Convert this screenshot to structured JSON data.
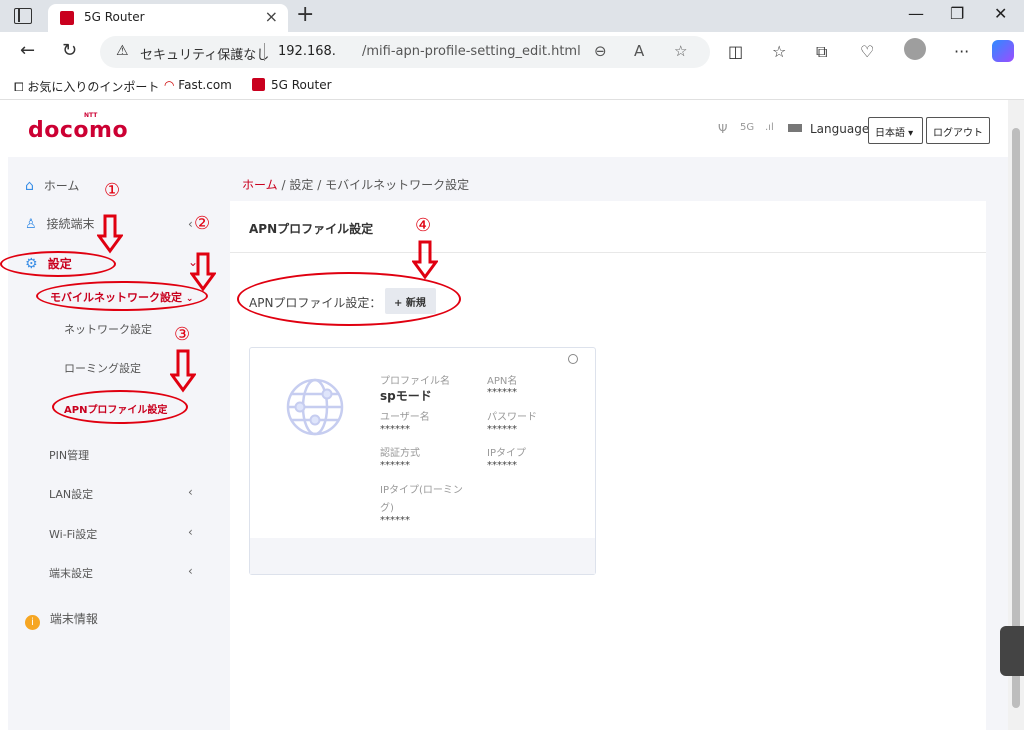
{
  "browser": {
    "tab_title": "5G Router",
    "security_text": "セキュリティ保護なし",
    "url_host": "192.168.",
    "url_path": "/mifi-apn-profile-setting_edit.html",
    "favorites": [
      "お気に入りのインポート",
      "Fast.com",
      "5G Router"
    ]
  },
  "header": {
    "logo": "docomo",
    "logo_small": "NTT",
    "network": "5G",
    "language_label": "Language",
    "language_button": "日本語 ▾",
    "logout_button": "ログアウト"
  },
  "sidebar": {
    "home": "ホーム",
    "devices": "接続端末",
    "settings": "設定",
    "mobile_network": "モバイルネットワーク設定",
    "network_settings": "ネットワーク設定",
    "roaming": "ローミング設定",
    "apn_profile": "APNプロファイル設定",
    "pin": "PIN管理",
    "lan": "LAN設定",
    "wifi": "Wi-Fi設定",
    "device_settings": "端末設定",
    "device_info": "端末情報"
  },
  "breadcrumb": {
    "home": "ホーム",
    "sep": "/",
    "settings": "設定",
    "mobile_network": "モバイルネットワーク設定"
  },
  "main": {
    "card_title": "APNプロファイル設定",
    "apn_label": "APNプロファイル設定：",
    "new_button": "+ 新規",
    "profile": {
      "profile_name_label": "プロファイル名",
      "profile_name": "spモード",
      "apn_name_label": "APN名",
      "apn_name": "******",
      "user_name_label": "ユーザー名",
      "user_name": "******",
      "password_label": "パスワード",
      "password": "******",
      "auth_label": "認証方式",
      "auth": "******",
      "ip_type_label": "IPタイプ",
      "ip_type": "******",
      "ip_roaming_label_1": "IPタイプ(ローミン",
      "ip_roaming_label_2": "グ)",
      "ip_roaming": "******"
    }
  },
  "annotations": [
    "①",
    "②",
    "③",
    "④"
  ],
  "colors": {
    "accent": "#c9001e",
    "annotation": "#e00010",
    "sidebar_bg": "#f4f5f9"
  }
}
